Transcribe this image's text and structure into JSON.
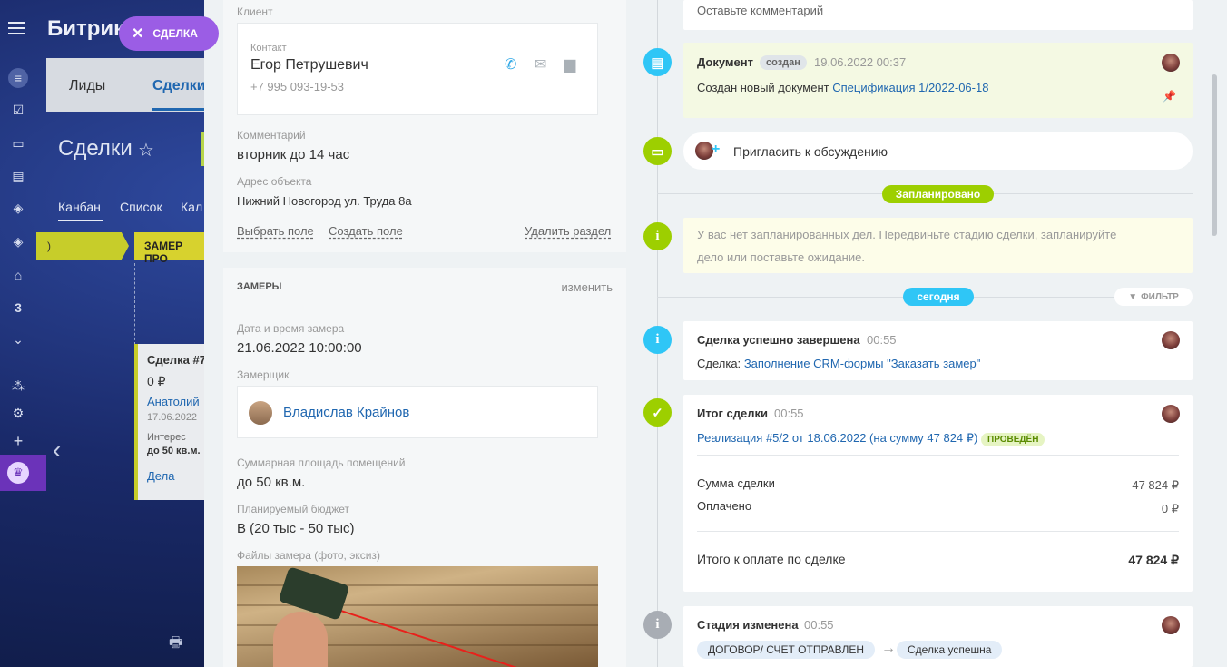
{
  "bg": {
    "brand": "Битрикс",
    "chip_label": "СДЕЛКА",
    "tab_leads": "Лиды",
    "tab_deals": "Сделки",
    "page_title": "Сделки",
    "view_kanban": "Канбан",
    "view_list": "Список",
    "view_cal": "Кал",
    "stage1": ")",
    "stage2": "ЗАМЕР ПРО",
    "card_title": "Сделка #7",
    "card_sum": "0 ₽",
    "card_contact": "Анатолий",
    "card_date": "17.06.2022",
    "card_interest_label": "Интерес",
    "card_interest": "до 50 кв.м.",
    "card_tasks": "Дела",
    "nav_num": "3"
  },
  "client": {
    "section_label": "Клиент",
    "contact_label": "Контакт",
    "contact_name": "Егор Петрушевич",
    "contact_phone": "+7 995 093-19-53",
    "comment_label": "Комментарий",
    "comment": "вторник до 14 час",
    "address_label": "Адрес объекта",
    "address": "Нижний Новогород ул. Труда 8а",
    "choose_field": "Выбрать поле",
    "create_field": "Создать поле",
    "delete_section": "Удалить раздел"
  },
  "zamery": {
    "title": "ЗАМЕРЫ",
    "edit": "изменить",
    "datetime_label": "Дата и время замера",
    "datetime": "21.06.2022 10:00:00",
    "measurer_label": "Замерщик",
    "measurer": "Владислав Крайнов",
    "area_label": "Суммарная площадь помещений",
    "area": "до 50 кв.м.",
    "budget_label": "Планируемый бюджет",
    "budget": "В (20 тыс - 50 тыс)",
    "files_label": "Файлы замера (фото, эксиз)"
  },
  "timeline": {
    "comment_placeholder": "Оставьте комментарий",
    "doc_title": "Документ",
    "doc_badge": "создан",
    "doc_time": "19.06.2022 00:37",
    "doc_text": "Создан новый документ",
    "doc_link": "Спецификация 1/2022-06-18",
    "invite": "Пригласить к обсуждению",
    "planned_pill": "Запланировано",
    "empty_text_1": "У вас нет запланированных дел. Передвиньте стадию сделки, запланируйте",
    "empty_text_2": "дело или поставьте ожидание.",
    "today_pill": "сегодня",
    "filter": "ФИЛЬТР",
    "done_title": "Сделка успешно завершена",
    "done_time": "00:55",
    "done_label": "Сделка:",
    "done_link": "Заполнение CRM-формы \"Заказать замер\"",
    "result_title": "Итог сделки",
    "result_time": "00:55",
    "result_link": "Реализация #5/2 от 18.06.2022 (на сумму 47 824 ₽)",
    "result_badge": "ПРОВЕДЁН",
    "sum_label": "Сумма сделки",
    "sum_value": "47 824 ₽",
    "paid_label": "Оплачено",
    "paid_value": "0 ₽",
    "total_label": "Итого к оплате по сделке",
    "total_value": "47 824 ₽",
    "stage_title": "Стадия изменена",
    "stage_time": "00:55",
    "stage_from": "ДОГОВОР/ СЧЕТ ОТПРАВЛЕН",
    "stage_to": "Сделка успешна"
  },
  "colors": {
    "accent": "#2067b0",
    "green": "#9dcf00",
    "blue_icon": "#2fc6f6",
    "grey_icon": "#a8adb4",
    "chip": "#9b5de5"
  },
  "icons": [
    "menu-icon",
    "filter-icon",
    "tasks-icon",
    "chat-icon",
    "contact-card-icon",
    "box-icon",
    "box-icon",
    "building-icon",
    "chevron-down-icon",
    "sitemap-icon",
    "gear-icon",
    "plus-icon",
    "crown-icon",
    "printer-icon",
    "close-icon",
    "star-icon",
    "phone-icon",
    "mail-icon",
    "message-icon",
    "document-icon",
    "comment-icon",
    "info-icon",
    "check-icon",
    "pin-icon"
  ]
}
